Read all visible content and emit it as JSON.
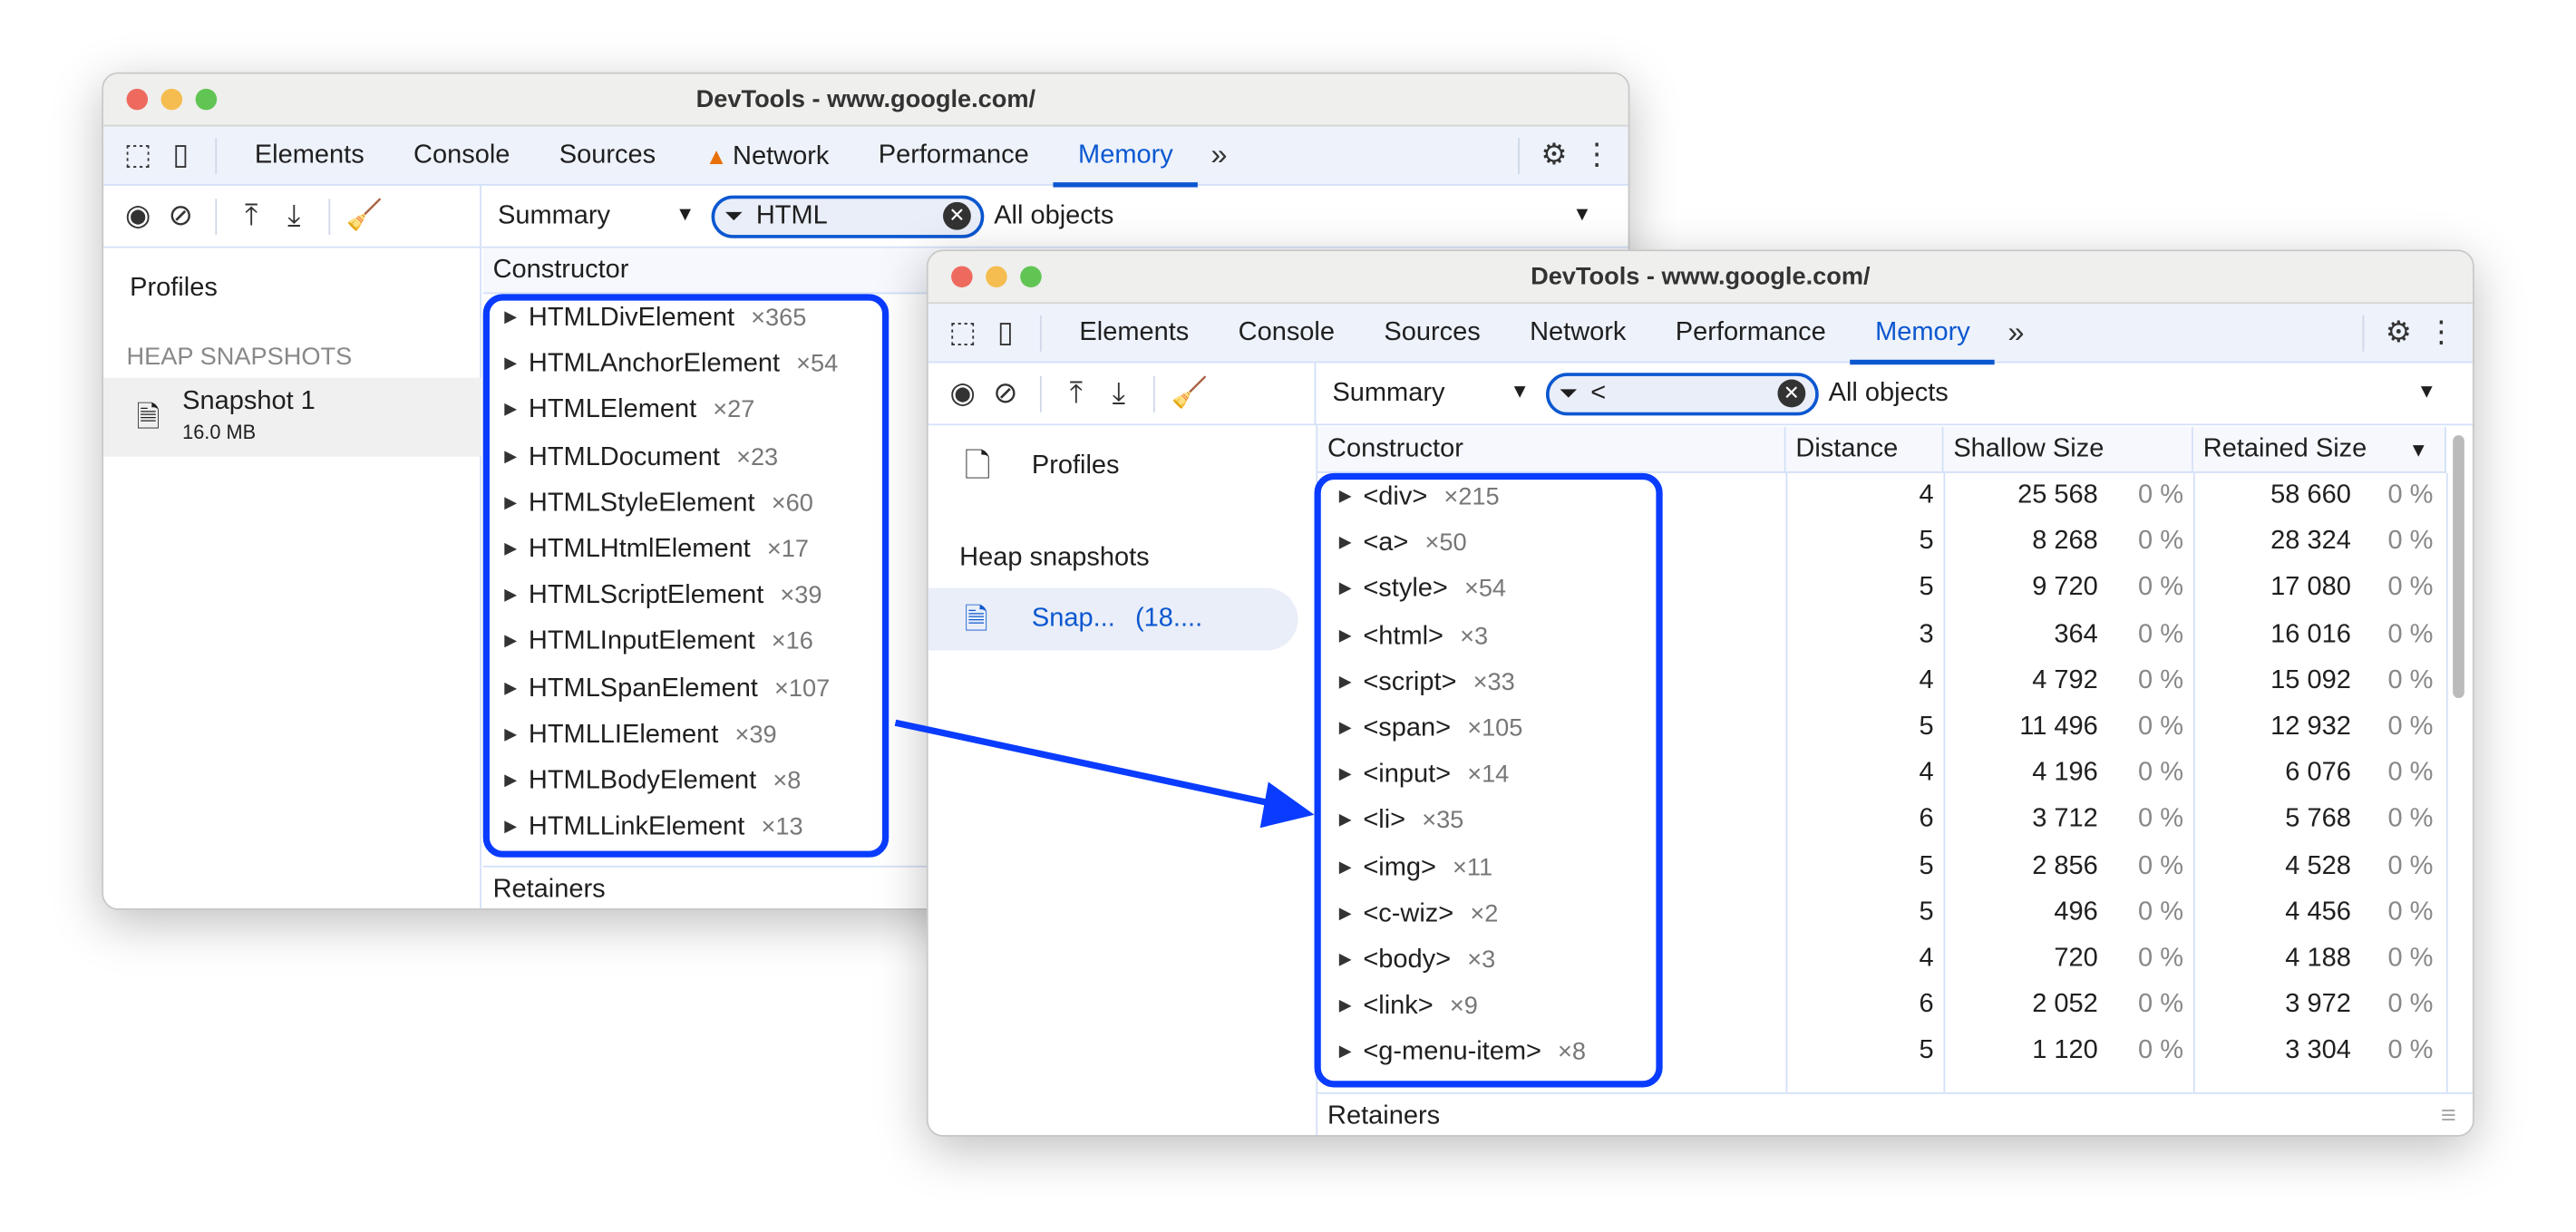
{
  "back": {
    "title": "DevTools - www.google.com/",
    "tabs": [
      "Elements",
      "Console",
      "Sources",
      "Network",
      "Performance",
      "Memory"
    ],
    "active_tab": "Memory",
    "network_warning_icon": "warning-triangle-icon",
    "view": "Summary",
    "filter": "HTML",
    "objects": "All objects",
    "sidebar": {
      "profiles": "Profiles",
      "section": "HEAP SNAPSHOTS",
      "snapshot_name": "Snapshot 1",
      "snapshot_size": "16.0 MB"
    },
    "column": "Constructor",
    "rows": [
      {
        "name": "HTMLDivElement",
        "count": "×365"
      },
      {
        "name": "HTMLAnchorElement",
        "count": "×54"
      },
      {
        "name": "HTMLElement",
        "count": "×27"
      },
      {
        "name": "HTMLDocument",
        "count": "×23"
      },
      {
        "name": "HTMLStyleElement",
        "count": "×60"
      },
      {
        "name": "HTMLHtmlElement",
        "count": "×17"
      },
      {
        "name": "HTMLScriptElement",
        "count": "×39"
      },
      {
        "name": "HTMLInputElement",
        "count": "×16"
      },
      {
        "name": "HTMLSpanElement",
        "count": "×107"
      },
      {
        "name": "HTMLLIElement",
        "count": "×39"
      },
      {
        "name": "HTMLBodyElement",
        "count": "×8"
      },
      {
        "name": "HTMLLinkElement",
        "count": "×13"
      }
    ],
    "retainers": "Retainers"
  },
  "front": {
    "title": "DevTools - www.google.com/",
    "tabs": [
      "Elements",
      "Console",
      "Sources",
      "Network",
      "Performance",
      "Memory"
    ],
    "active_tab": "Memory",
    "view": "Summary",
    "filter": "<",
    "objects": "All objects",
    "sidebar": {
      "profiles": "Profiles",
      "section": "Heap snapshots",
      "snapshot_name": "Snap...",
      "snapshot_size": "(18...."
    },
    "columns": [
      "Constructor",
      "Distance",
      "Shallow Size",
      "Retained Size"
    ],
    "rows": [
      {
        "name": "<div>",
        "count": "×215",
        "distance": "4",
        "shallow": "25 568",
        "shallow_pct": "0 %",
        "retained": "58 660",
        "retained_pct": "0 %"
      },
      {
        "name": "<a>",
        "count": "×50",
        "distance": "5",
        "shallow": "8 268",
        "shallow_pct": "0 %",
        "retained": "28 324",
        "retained_pct": "0 %"
      },
      {
        "name": "<style>",
        "count": "×54",
        "distance": "5",
        "shallow": "9 720",
        "shallow_pct": "0 %",
        "retained": "17 080",
        "retained_pct": "0 %"
      },
      {
        "name": "<html>",
        "count": "×3",
        "distance": "3",
        "shallow": "364",
        "shallow_pct": "0 %",
        "retained": "16 016",
        "retained_pct": "0 %"
      },
      {
        "name": "<script>",
        "count": "×33",
        "distance": "4",
        "shallow": "4 792",
        "shallow_pct": "0 %",
        "retained": "15 092",
        "retained_pct": "0 %"
      },
      {
        "name": "<span>",
        "count": "×105",
        "distance": "5",
        "shallow": "11 496",
        "shallow_pct": "0 %",
        "retained": "12 932",
        "retained_pct": "0 %"
      },
      {
        "name": "<input>",
        "count": "×14",
        "distance": "4",
        "shallow": "4 196",
        "shallow_pct": "0 %",
        "retained": "6 076",
        "retained_pct": "0 %"
      },
      {
        "name": "<li>",
        "count": "×35",
        "distance": "6",
        "shallow": "3 712",
        "shallow_pct": "0 %",
        "retained": "5 768",
        "retained_pct": "0 %"
      },
      {
        "name": "<img>",
        "count": "×11",
        "distance": "5",
        "shallow": "2 856",
        "shallow_pct": "0 %",
        "retained": "4 528",
        "retained_pct": "0 %"
      },
      {
        "name": "<c-wiz>",
        "count": "×2",
        "distance": "5",
        "shallow": "496",
        "shallow_pct": "0 %",
        "retained": "4 456",
        "retained_pct": "0 %"
      },
      {
        "name": "<body>",
        "count": "×3",
        "distance": "4",
        "shallow": "720",
        "shallow_pct": "0 %",
        "retained": "4 188",
        "retained_pct": "0 %"
      },
      {
        "name": "<link>",
        "count": "×9",
        "distance": "6",
        "shallow": "2 052",
        "shallow_pct": "0 %",
        "retained": "3 972",
        "retained_pct": "0 %"
      },
      {
        "name": "<g-menu-item>",
        "count": "×8",
        "distance": "5",
        "shallow": "1 120",
        "shallow_pct": "0 %",
        "retained": "3 304",
        "retained_pct": "0 %"
      }
    ],
    "retainers": "Retainers"
  },
  "colors": {
    "accent": "#0b57d0",
    "highlight": "#0a3cff",
    "warning": "#e8710a"
  }
}
